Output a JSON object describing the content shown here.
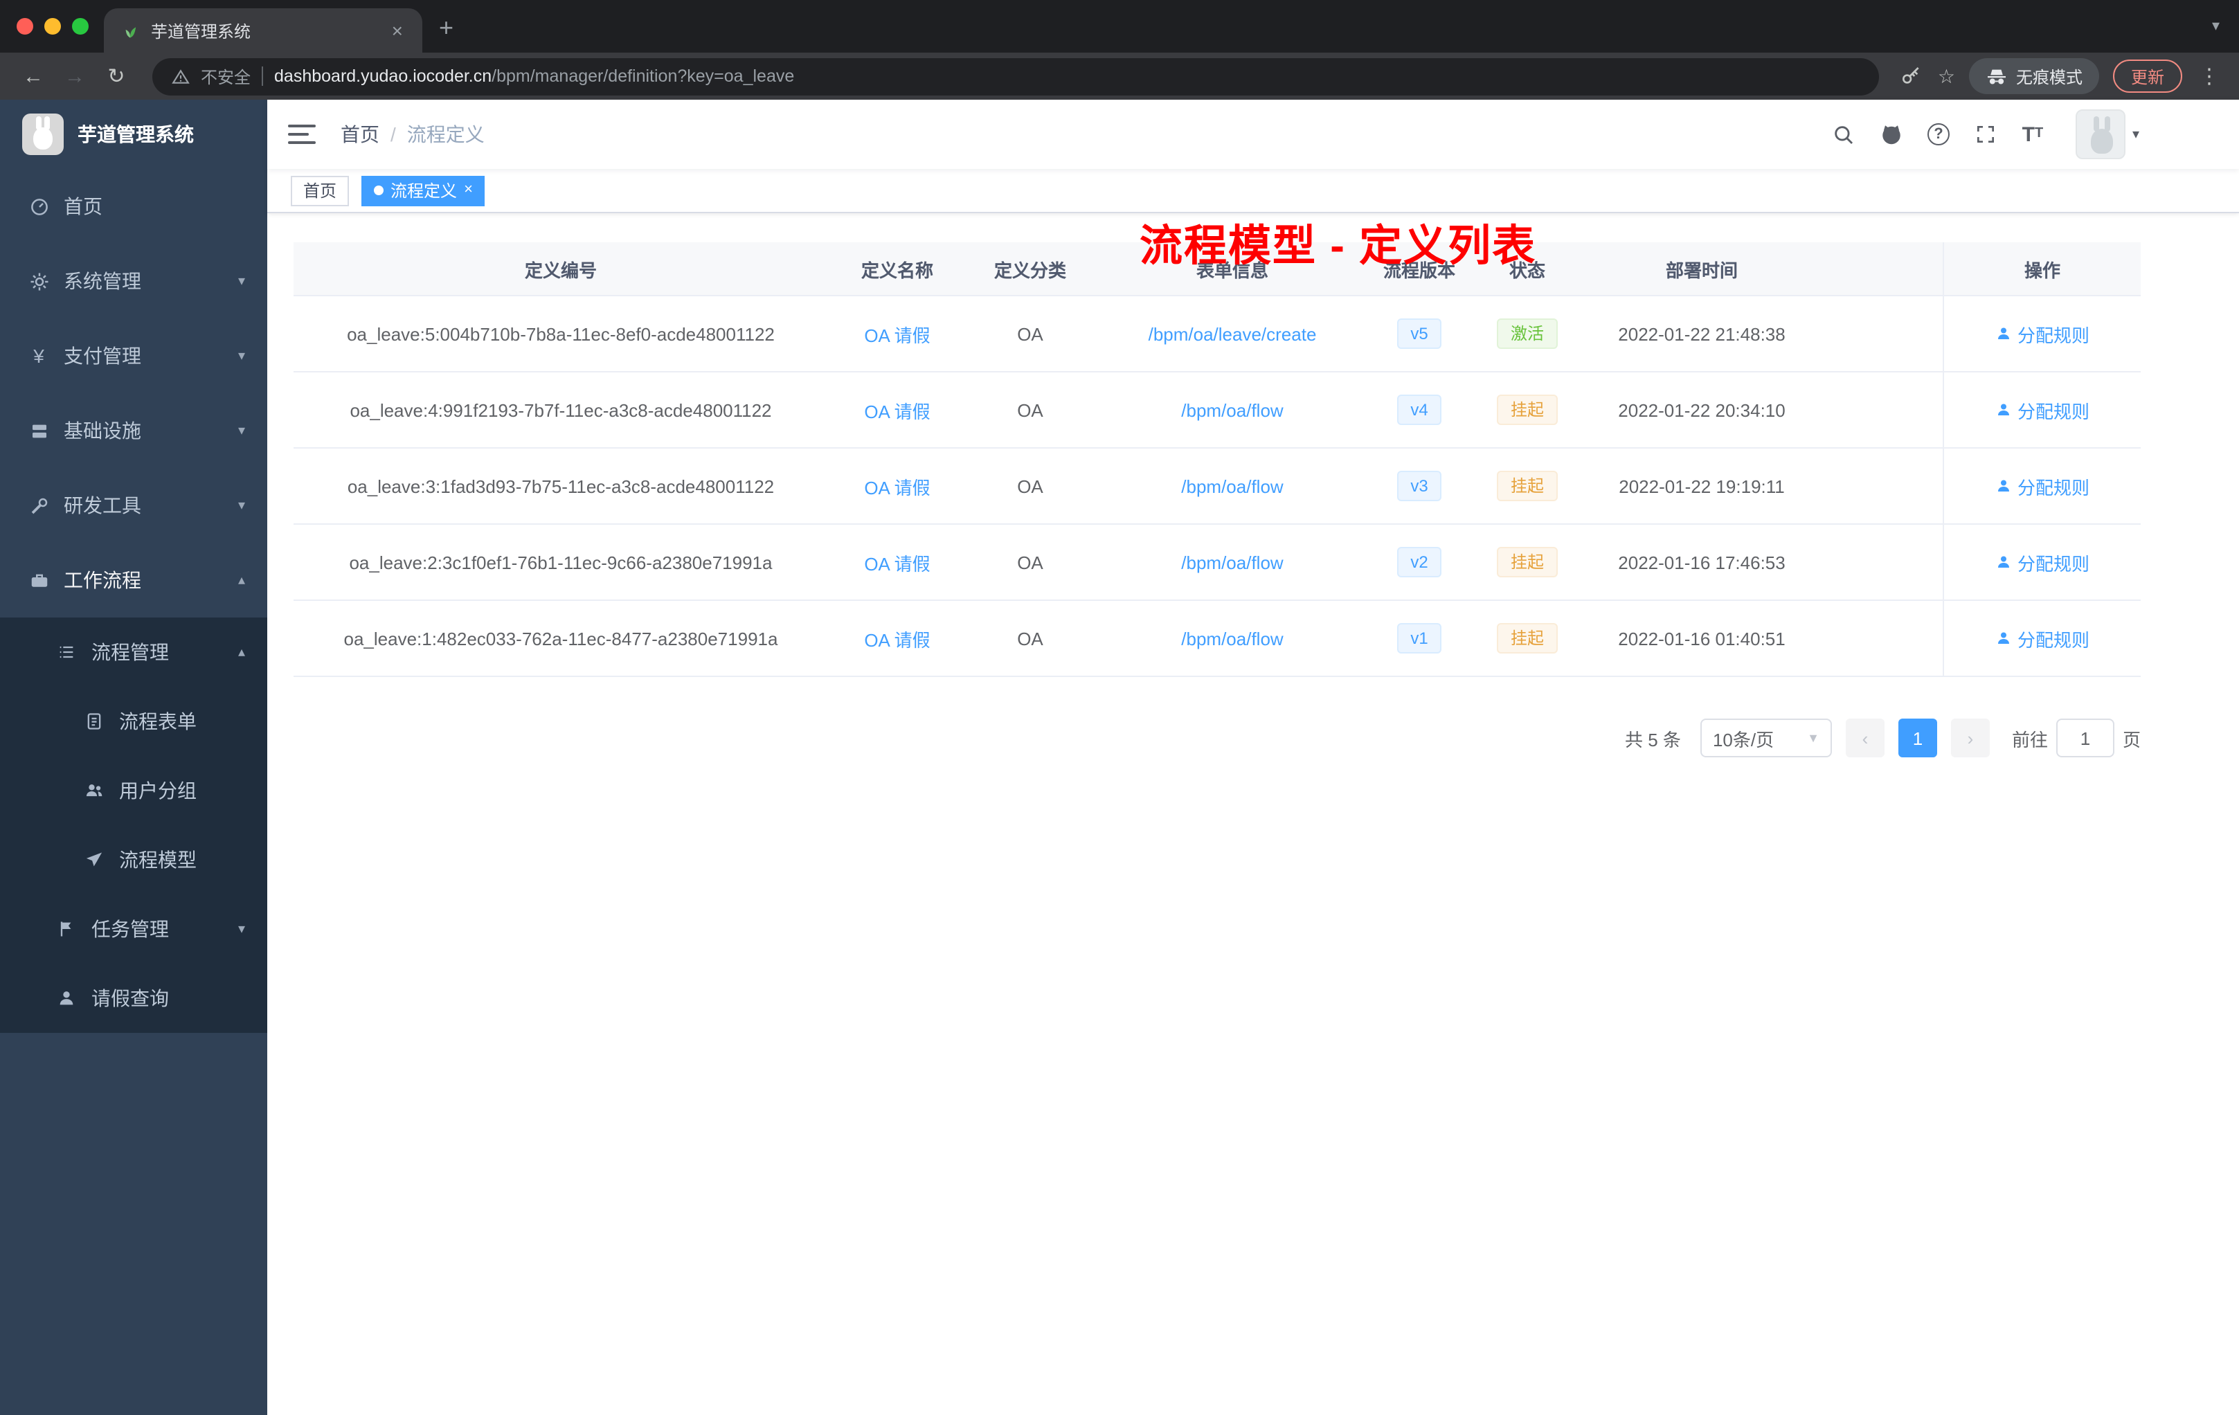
{
  "browser": {
    "tab_title": "芋道管理系统",
    "address": {
      "security_label": "不安全",
      "domain": "dashboard.yudao.iocoder.cn",
      "path": "/bpm/manager/definition?key=oa_leave"
    },
    "incognito_label": "无痕模式",
    "update_label": "更新"
  },
  "sidebar": {
    "app_title": "芋道管理系统",
    "items": [
      {
        "label": "首页",
        "icon": "dashboard-icon"
      },
      {
        "label": "系统管理",
        "icon": "gear-icon"
      },
      {
        "label": "支付管理",
        "icon": "payment-icon"
      },
      {
        "label": "基础设施",
        "icon": "infrastructure-icon"
      },
      {
        "label": "研发工具",
        "icon": "devtools-icon"
      },
      {
        "label": "工作流程",
        "icon": "workflow-icon"
      }
    ],
    "submenu": {
      "group_label": "流程管理",
      "children": [
        {
          "label": "流程表单",
          "icon": "form-icon"
        },
        {
          "label": "用户分组",
          "icon": "user-group-icon"
        },
        {
          "label": "流程模型",
          "icon": "paper-plane-icon"
        }
      ],
      "task_label": "任务管理",
      "leave_label": "请假查询"
    }
  },
  "navbar": {
    "breadcrumb": {
      "home": "首页",
      "current": "流程定义"
    },
    "annotation": "流程模型 - 定义列表"
  },
  "tags": {
    "home": "首页",
    "active": "流程定义"
  },
  "table": {
    "columns": [
      "定义编号",
      "定义名称",
      "定义分类",
      "表单信息",
      "流程版本",
      "状态",
      "部署时间",
      "操作"
    ],
    "rows": [
      {
        "id": "oa_leave:5:004b710b-7b8a-11ec-8ef0-acde48001122",
        "name": "OA 请假",
        "category": "OA",
        "form": "/bpm/oa/leave/create",
        "version": "v5",
        "status": "激活",
        "status_class": "cell-tag t-success",
        "time": "2022-01-22 21:48:38",
        "action": "分配规则"
      },
      {
        "id": "oa_leave:4:991f2193-7b7f-11ec-a3c8-acde48001122",
        "name": "OA 请假",
        "category": "OA",
        "form": "/bpm/oa/flow",
        "version": "v4",
        "status": "挂起",
        "status_class": "cell-tag t-warning",
        "time": "2022-01-22 20:34:10",
        "action": "分配规则"
      },
      {
        "id": "oa_leave:3:1fad3d93-7b75-11ec-a3c8-acde48001122",
        "name": "OA 请假",
        "category": "OA",
        "form": "/bpm/oa/flow",
        "version": "v3",
        "status": "挂起",
        "status_class": "cell-tag t-warning",
        "time": "2022-01-22 19:19:11",
        "action": "分配规则"
      },
      {
        "id": "oa_leave:2:3c1f0ef1-76b1-11ec-9c66-a2380e71991a",
        "name": "OA 请假",
        "category": "OA",
        "form": "/bpm/oa/flow",
        "version": "v2",
        "status": "挂起",
        "status_class": "cell-tag t-warning",
        "time": "2022-01-16 17:46:53",
        "action": "分配规则"
      },
      {
        "id": "oa_leave:1:482ec033-762a-11ec-8477-a2380e71991a",
        "name": "OA 请假",
        "category": "OA",
        "form": "/bpm/oa/flow",
        "version": "v1",
        "status": "挂起",
        "status_class": "cell-tag t-warning",
        "time": "2022-01-16 01:40:51",
        "action": "分配规则"
      }
    ]
  },
  "pagination": {
    "total": "共 5 条",
    "page_size": "10条/页",
    "page": "1",
    "goto": "前往",
    "unit": "页",
    "goto_value": "1"
  },
  "colors": {
    "primary": "#409eff",
    "success": "#67c23a",
    "warning": "#e6a23c",
    "annotation": "#fe0000",
    "sidebar_bg": "#304156",
    "submenu_bg": "#1f2d3d"
  }
}
